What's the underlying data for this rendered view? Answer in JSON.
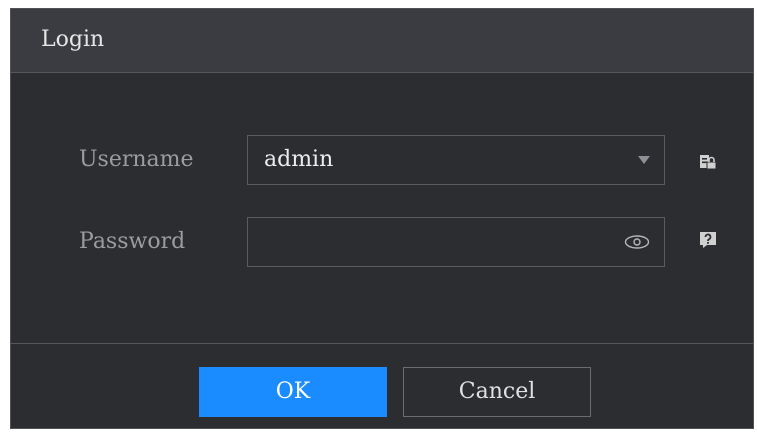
{
  "dialog": {
    "title": "Login"
  },
  "form": {
    "username_label": "Username",
    "username_value": "admin",
    "password_label": "Password",
    "password_value": ""
  },
  "buttons": {
    "ok_label": "OK",
    "cancel_label": "Cancel"
  },
  "icons": {
    "dropdown": "chevron-down-icon",
    "show_password": "eye-icon",
    "user_management": "user-management-icon",
    "help": "help-icon"
  },
  "colors": {
    "accent": "#1a8cff",
    "background": "#2c2d31",
    "title_bar": "#3b3c41"
  }
}
